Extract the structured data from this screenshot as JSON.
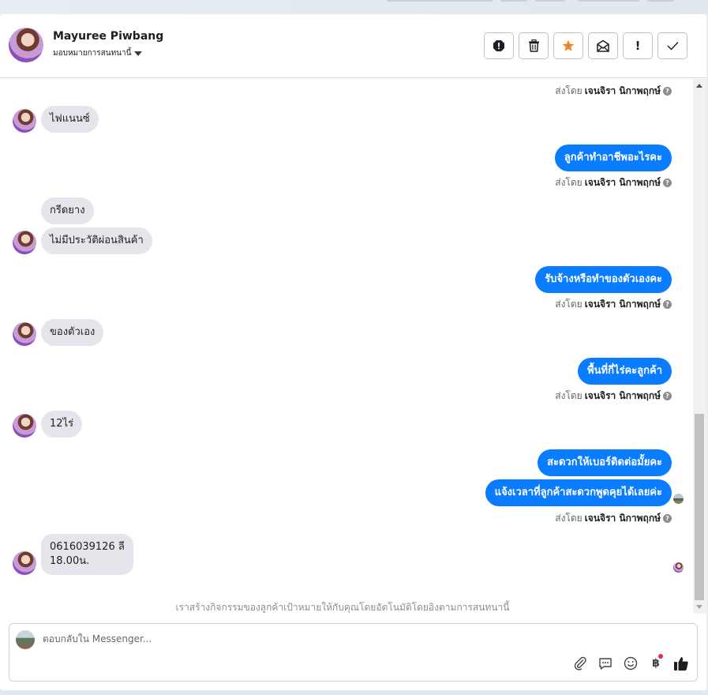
{
  "header": {
    "name": "Mayuree Piwbang",
    "assign_label": "มอบหมายการสนทนานี้",
    "actions": [
      "report-icon",
      "trash-icon",
      "star-icon",
      "mail-icon",
      "important-icon",
      "check-icon"
    ],
    "important_glyph": "!"
  },
  "colors": {
    "outgoing": "#0a7cff",
    "incoming": "#e4e6eb",
    "star": "#f5821f",
    "badge": "#f02849"
  },
  "sent_by": {
    "prefix": "ส่งโดย",
    "agent": "เจนจิรา นิกาพฤกษ์",
    "help": "?"
  },
  "messages": {
    "m1": "ไฟแนนซ์",
    "m2": "ลูกค้าทำอาชีพอะไรคะ",
    "m3": "กรีดยาง",
    "m4": "ไม่มีประวัติผ่อนสินค้า",
    "m5": "รับจ้างหรือทำของตัวเองคะ",
    "m6": "ของตัวเอง",
    "m7": "พื้นที่กี่ไร่คะลูกค้า",
    "m8": "12ไร่",
    "m9": "สะดวกให้เบอร์ติดต่อมั้ยคะ",
    "m10": "แจ้งเวลาที่ลูกค้าสะดวกพูดคุยได้เลยค่ะ",
    "m11_line1": "0616039126 ลี",
    "m11_line2": "18.00น."
  },
  "system_note": "เราสร้างกิจกรรมของลูกค้าเป้าหมายให้กับคุณโดยอัตโนมัติโดยอิงตามการสนทนานี้",
  "composer": {
    "placeholder": "ตอบกลับใน Messenger...",
    "tools": [
      "attach-icon",
      "saved-reply-icon",
      "emoji-icon",
      "payment-icon",
      "like-icon"
    ],
    "currency_glyph": "฿"
  }
}
